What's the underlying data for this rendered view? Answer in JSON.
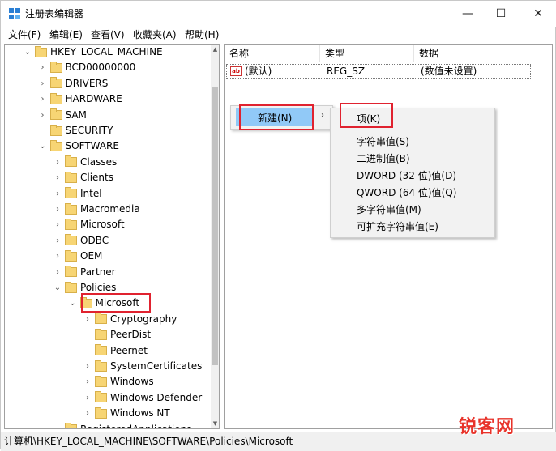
{
  "window": {
    "title": "注册表编辑器",
    "minimize_glyph": "—",
    "maximize_glyph": "☐",
    "close_glyph": "✕"
  },
  "menubar": [
    "文件(F)",
    "编辑(E)",
    "查看(V)",
    "收藏夹(A)",
    "帮助(H)"
  ],
  "tree": {
    "items": [
      {
        "label": "HKEY_LOCAL_MACHINE",
        "depth": 0,
        "arrow": "expanded"
      },
      {
        "label": "BCD00000000",
        "depth": 1,
        "arrow": "collapsed"
      },
      {
        "label": "DRIVERS",
        "depth": 1,
        "arrow": "collapsed"
      },
      {
        "label": "HARDWARE",
        "depth": 1,
        "arrow": "collapsed"
      },
      {
        "label": "SAM",
        "depth": 1,
        "arrow": "collapsed"
      },
      {
        "label": "SECURITY",
        "depth": 1,
        "arrow": "none"
      },
      {
        "label": "SOFTWARE",
        "depth": 1,
        "arrow": "expanded"
      },
      {
        "label": "Classes",
        "depth": 2,
        "arrow": "collapsed"
      },
      {
        "label": "Clients",
        "depth": 2,
        "arrow": "collapsed"
      },
      {
        "label": "Intel",
        "depth": 2,
        "arrow": "collapsed"
      },
      {
        "label": "Macromedia",
        "depth": 2,
        "arrow": "collapsed"
      },
      {
        "label": "Microsoft",
        "depth": 2,
        "arrow": "collapsed"
      },
      {
        "label": "ODBC",
        "depth": 2,
        "arrow": "collapsed"
      },
      {
        "label": "OEM",
        "depth": 2,
        "arrow": "collapsed"
      },
      {
        "label": "Partner",
        "depth": 2,
        "arrow": "collapsed"
      },
      {
        "label": "Policies",
        "depth": 2,
        "arrow": "expanded"
      },
      {
        "label": "Microsoft",
        "depth": 3,
        "arrow": "expanded",
        "selected": true
      },
      {
        "label": "Cryptography",
        "depth": 4,
        "arrow": "collapsed"
      },
      {
        "label": "PeerDist",
        "depth": 4,
        "arrow": "none"
      },
      {
        "label": "Peernet",
        "depth": 4,
        "arrow": "none"
      },
      {
        "label": "SystemCertificates",
        "depth": 4,
        "arrow": "collapsed"
      },
      {
        "label": "Windows",
        "depth": 4,
        "arrow": "collapsed"
      },
      {
        "label": "Windows Defender",
        "depth": 4,
        "arrow": "collapsed"
      },
      {
        "label": "Windows NT",
        "depth": 4,
        "arrow": "collapsed"
      },
      {
        "label": "RegisteredApplications",
        "depth": 2,
        "arrow": "none"
      }
    ]
  },
  "list": {
    "columns": [
      "名称",
      "类型",
      "数据"
    ],
    "rows": [
      {
        "name": "(默认)",
        "type": "REG_SZ",
        "data": "(数值未设置)"
      }
    ]
  },
  "context_menu": {
    "new_label": "新建(N)",
    "arrow": "›"
  },
  "submenu": [
    "项(K)",
    "字符串值(S)",
    "二进制值(B)",
    "DWORD (32 位)值(D)",
    "QWORD (64 位)值(Q)",
    "多字符串值(M)",
    "可扩充字符串值(E)"
  ],
  "status": "计算机\\HKEY_LOCAL_MACHINE\\SOFTWARE\\Policies\\Microsoft",
  "watermark": "锐客网",
  "colors": {
    "highlight_border": "#e0222f",
    "menu_selected": "#91c9f7",
    "folder": "#f7d574"
  }
}
